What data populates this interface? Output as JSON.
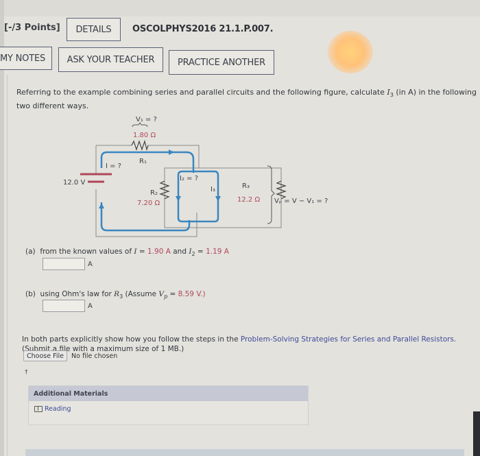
{
  "header": {
    "points": "[-/3 Points]",
    "details_label": "DETAILS",
    "problem_id": "OSCOLPHYS2016 21.1.P.007.",
    "my_notes_label": "MY NOTES",
    "ask_teacher_label": "ASK YOUR TEACHER",
    "practice_another_label": "PRACTICE ANOTHER"
  },
  "prompt": {
    "text_before": "Referring to the example combining series and parallel circuits and the following figure, calculate ",
    "var": "I",
    "var_sub": "3",
    "text_after": " (in A) in the following two different ways."
  },
  "circuit": {
    "v1_label": "V₁ = ?",
    "r1_value": "1.80 Ω",
    "r1_label": "R₁",
    "i_label": "I = ?",
    "battery_label": "12.0 V",
    "i2_label": "I₂ = ?",
    "r2_label": "R₂",
    "r2_value": "7.20 Ω",
    "i3_label": "I₃",
    "r3_label": "R₃",
    "r3_value": "12.2 Ω",
    "vp_label": "Vₚ = V − V₁ = ?"
  },
  "part_a": {
    "prefix": "(a)",
    "text": "from the known values of ",
    "i_var": "I",
    "eq1": " = ",
    "i_value": "1.90 A",
    "and": " and ",
    "i2_var": "I",
    "i2_sub": "2",
    "eq2": " = ",
    "i2_value": "1.19 A",
    "answer_value": "",
    "unit": "A"
  },
  "part_b": {
    "prefix": "(b)",
    "text": "using Ohm's law for ",
    "r_var": "R",
    "r_sub": "3",
    "assume": " (Assume ",
    "v_var": "V",
    "v_sub": "p",
    "eq": " = ",
    "v_value": "8.59 V.)",
    "answer_value": "",
    "unit": "A"
  },
  "instructions": {
    "text": "In both parts explicitly show how you follow the steps in the ",
    "link": "Problem-Solving Strategies for Series and Parallel Resistors.",
    "limit": "(Submit a file with a maximum size of 1 MB.)"
  },
  "file_upload": {
    "button_label": "Choose File",
    "status": "No file chosen"
  },
  "dagger": "†",
  "materials": {
    "title": "Additional Materials",
    "items": [
      {
        "label": "Reading",
        "icon": "book-icon"
      }
    ]
  },
  "colors": {
    "value_red": "#b0475a",
    "link_blue": "#3f4a9a",
    "current_blue": "#3b86c0",
    "wire_gray": "#8a8a8a"
  }
}
